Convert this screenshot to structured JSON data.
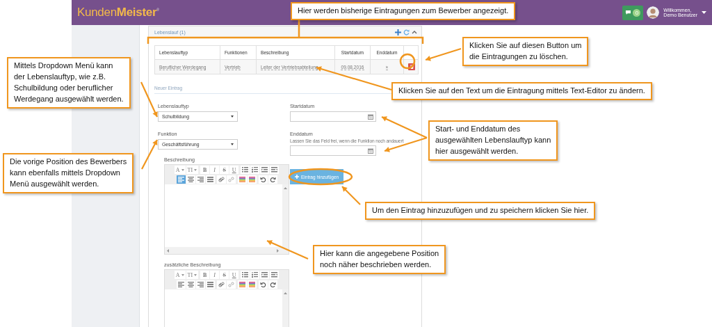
{
  "header": {
    "logo": {
      "first": "Kunden",
      "second": "Meister",
      "mark": "®"
    },
    "messages_count": "0",
    "greeting": "Willkommen,",
    "user_name": "Demo Benutzer"
  },
  "panel": {
    "title": "Lebenslauf (1)",
    "table": {
      "columns": [
        "Lebenslauftyp",
        "Funktionen",
        "Beschreibung",
        "Startdatum",
        "Enddatum"
      ],
      "rows": [
        {
          "cells": [
            "Beruflicher Werdegang",
            "Vertrieb",
            "Leiter der Vertriebsabteilung",
            "09.08.2016",
            "×"
          ]
        }
      ]
    },
    "new_entry": {
      "title": "Neuer Eintrag",
      "selects": [
        {
          "label": "Lebenslauftyp",
          "value": "Schulbildung"
        },
        {
          "label": "Funktion",
          "value": "Geschäftsführung"
        }
      ],
      "dates": [
        {
          "label": "Startdatum"
        },
        {
          "label": "Enddatum",
          "hint": "Lassen Sie das Feld frei, wenn die Funktion noch andauert"
        }
      ],
      "add_button": "Eintrag hinzufügen",
      "editors": [
        {
          "label": "Beschreibung",
          "toolbar": [
            [
              [
                {
                  "kind": "dropdown",
                  "label": "A"
                },
                {
                  "kind": "dropdown",
                  "label": "TI"
                }
              ],
              [
                {
                  "kind": "bold",
                  "label": "B"
                },
                {
                  "kind": "italic",
                  "label": "I"
                },
                {
                  "kind": "strike",
                  "label": "S"
                },
                {
                  "kind": "underline",
                  "label": "U"
                }
              ],
              [
                {
                  "kind": "bullet-list"
                },
                {
                  "kind": "number-list"
                },
                {
                  "kind": "outdent"
                },
                {
                  "kind": "indent"
                }
              ]
            ],
            [
              [
                {
                  "kind": "align-left",
                  "selected": true
                },
                {
                  "kind": "align-center",
                  "selected": false
                },
                {
                  "kind": "align-right",
                  "selected": false
                },
                {
                  "kind": "justify",
                  "selected": false
                }
              ],
              [
                {
                  "kind": "link"
                },
                {
                  "kind": "unlink"
                }
              ],
              [
                {
                  "kind": "text-color"
                },
                {
                  "kind": "background-color"
                }
              ],
              [
                {
                  "kind": "undo"
                },
                {
                  "kind": "redo"
                }
              ]
            ]
          ]
        },
        {
          "label": "zusätzliche Beschreibung",
          "toolbar": [
            [
              [
                {
                  "kind": "dropdown",
                  "label": "A"
                },
                {
                  "kind": "dropdown",
                  "label": "TI"
                }
              ],
              [
                {
                  "kind": "bold",
                  "label": "B"
                },
                {
                  "kind": "italic",
                  "label": "I"
                },
                {
                  "kind": "strike",
                  "label": "S"
                },
                {
                  "kind": "underline",
                  "label": "U"
                }
              ],
              [
                {
                  "kind": "bullet-list"
                },
                {
                  "kind": "number-list"
                },
                {
                  "kind": "outdent"
                },
                {
                  "kind": "indent"
                }
              ]
            ],
            [
              [
                {
                  "kind": "align-left",
                  "selected": false
                },
                {
                  "kind": "align-center",
                  "selected": false
                },
                {
                  "kind": "align-right",
                  "selected": false
                },
                {
                  "kind": "justify",
                  "selected": false
                }
              ],
              [
                {
                  "kind": "link"
                },
                {
                  "kind": "unlink"
                }
              ],
              [
                {
                  "kind": "text-color"
                },
                {
                  "kind": "background-color"
                }
              ],
              [
                {
                  "kind": "undo"
                },
                {
                  "kind": "redo"
                }
              ]
            ]
          ]
        }
      ]
    }
  },
  "callouts": [
    {
      "text": "Hier werden bisherige Eintragungen zum Bewerber angezeigt."
    },
    {
      "text": "Klicken Sie auf diesen Button um\ndie Eintragungen zu löschen."
    },
    {
      "text": "Mittels Dropdown Menü kann\nder Lebenslauftyp, wie z.B.\nSchulbildung oder beruflicher\nWerdegang ausgewählt werden."
    },
    {
      "text": "Klicken Sie auf den Text um die Eintragung mittels Text-Editor zu ändern."
    },
    {
      "text": "Start- und Enddatum des\nausgewählten Lebenslauftyp kann\nhier ausgewählt werden."
    },
    {
      "text": "Die vorige Position des Bewerbers\nkann ebenfalls mittels Dropdown\nMenü ausgewählt werden."
    },
    {
      "text": "Um den Eintrag hinzuzufügen und zu speichern klicken Sie hier."
    },
    {
      "text": "Hier kann die angegebene Position\nnoch näher beschrieben werden."
    }
  ]
}
